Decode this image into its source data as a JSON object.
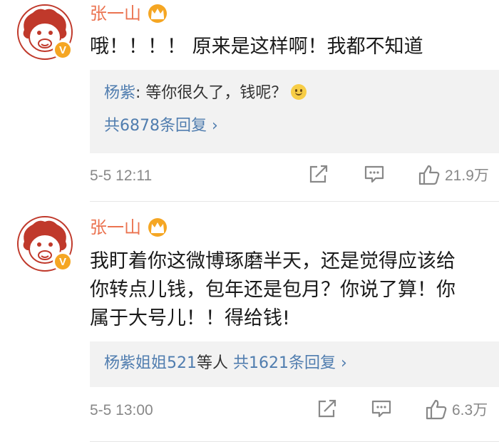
{
  "comments": [
    {
      "username": "张一山",
      "text_lines": [
        "哦！！！！ 原来是这样啊！我都不知道"
      ],
      "reply": {
        "user": "杨紫",
        "text": ": 等你很久了，钱呢？",
        "count_label": "共6878条回复 ›"
      },
      "time": "5-5 12:11",
      "likes": "21.9万"
    },
    {
      "username": "张一山",
      "text_lines": [
        "我盯着你这微博琢磨半天，还是觉得应该给",
        "你转点儿钱，包年还是包月？你说了算！你",
        "属于大号儿！！得给钱!"
      ],
      "reply": {
        "user": "杨紫姐姐521",
        "mid": "等人 ",
        "count_label": "共1621条回复 ›"
      },
      "time": "5-5 13:00",
      "likes": "6.3万"
    }
  ],
  "colors": {
    "username": "#eb7350",
    "link": "#507daf",
    "badge": "#f5a623",
    "reply_bg": "#f2f2f2"
  },
  "icons": [
    "avatar-monkey",
    "verified-badge",
    "crown-icon",
    "smile-emoji",
    "share-icon",
    "comment-icon",
    "like-icon"
  ]
}
